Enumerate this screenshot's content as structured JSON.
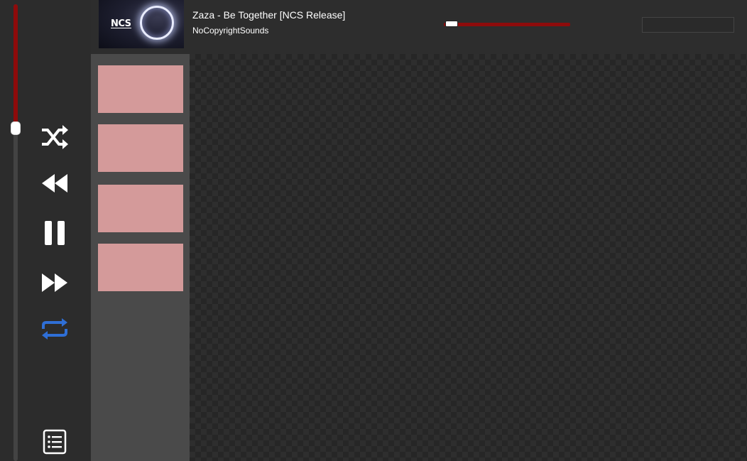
{
  "player": {
    "track_title": "Zaza - Be Together [NCS Release]",
    "track_artist": "NoCopyrightSounds",
    "album_art_logo": "NCS",
    "progress_fraction": 0.05,
    "volume_fraction": 0.27
  },
  "controls": {
    "shuffle_icon": "shuffle-icon",
    "previous_icon": "rewind-icon",
    "play_pause_icon": "pause-icon",
    "next_icon": "fast-forward-icon",
    "repeat_icon": "repeat-icon",
    "playlist_icon": "list-icon"
  },
  "search": {
    "value": "",
    "placeholder": ""
  },
  "playlists": [
    {
      "label": ""
    },
    {
      "label": ""
    },
    {
      "label": ""
    },
    {
      "label": ""
    }
  ],
  "colors": {
    "accent": "#8e0b0b",
    "repeat_active": "#2f6fd6",
    "playlist_tile": "#d49a9a"
  }
}
